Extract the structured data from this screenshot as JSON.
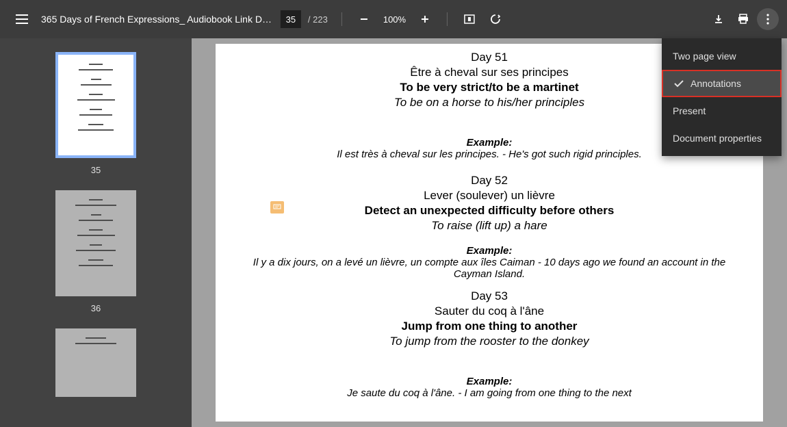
{
  "header": {
    "title": "365 Days of French Expressions_ Audiobook Link Do...",
    "page_current": "35",
    "page_total": "/ 223",
    "zoom": "100%"
  },
  "menu": {
    "two_page": "Two page view",
    "annotations": "Annotations",
    "present": "Present",
    "doc_props": "Document properties"
  },
  "thumbs": {
    "page35": "35",
    "page36": "36"
  },
  "doc": {
    "e1": {
      "day": "Day 51",
      "french": "Être à cheval sur ses principes",
      "english": "To be very strict/to be a martinet",
      "literal": "To be on a horse to his/her principles",
      "example_lbl": "Example:",
      "example_txt": "Il est très à cheval sur les principes. - He's got such rigid principles."
    },
    "e2": {
      "day": "Day 52",
      "french": "Lever (soulever) un lièvre",
      "english": "Detect an unexpected difficulty before others",
      "literal": "To raise (lift up) a hare",
      "example_lbl": "Example:",
      "example_txt": "Il y a dix jours, on a levé un lièvre, un compte aux îles Caiman - 10 days ago we found an account in the Cayman Island."
    },
    "e3": {
      "day": "Day 53",
      "french": "Sauter du coq à l'âne",
      "english": "Jump from one thing to another",
      "literal": "To jump from the rooster to the donkey",
      "example_lbl": "Example:",
      "example_txt": "Je saute du coq à l'âne. - I am going from one thing to the next"
    }
  }
}
